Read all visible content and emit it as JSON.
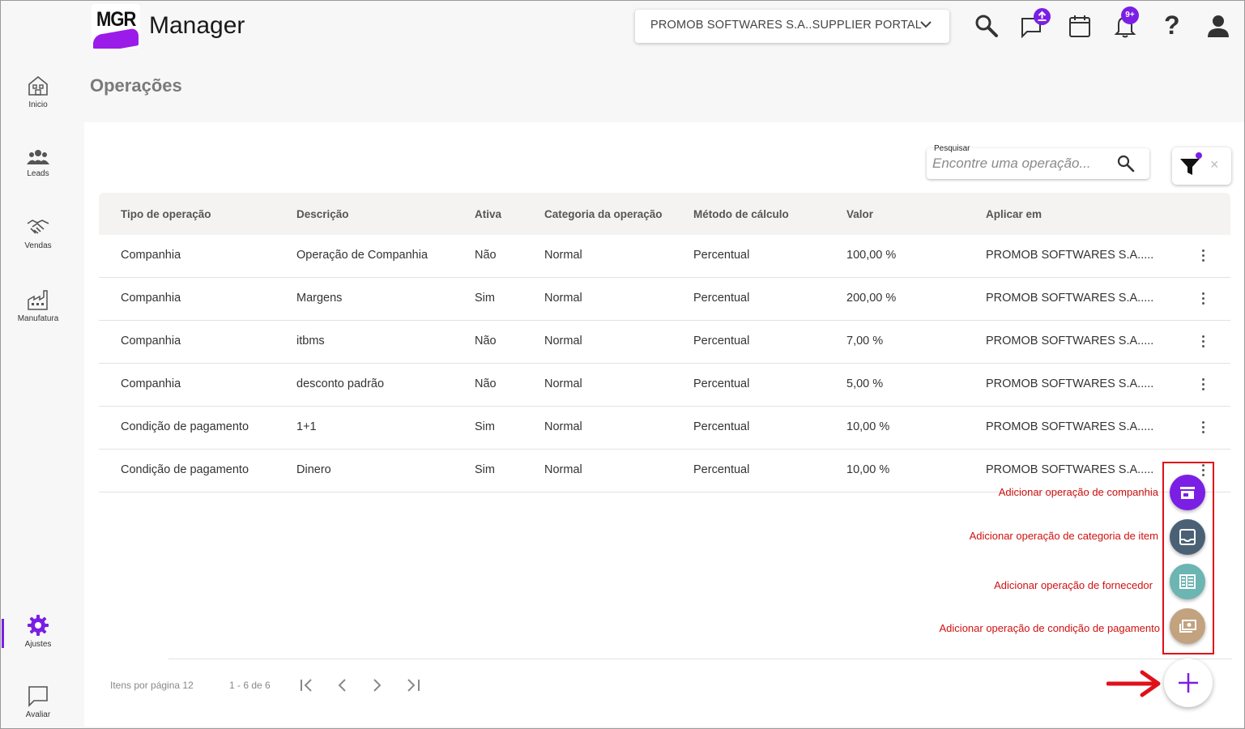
{
  "app": {
    "logo_text": "MGR",
    "name": "Manager"
  },
  "header": {
    "company": "PROMOB SOFTWARES S.A..SUPPLIER PORTAL",
    "chat_badge_icon": "upload-icon",
    "notifications_badge": "9+",
    "help_label": "?"
  },
  "sidebar": {
    "items": [
      {
        "label": "Inicio",
        "icon": "home-icon"
      },
      {
        "label": "Leads",
        "icon": "people-icon"
      },
      {
        "label": "Vendas",
        "icon": "handshake-icon"
      },
      {
        "label": "Manufatura",
        "icon": "factory-icon"
      },
      {
        "label": "Ajustes",
        "icon": "gear-icon"
      },
      {
        "label": "Avaliar",
        "icon": "chat-icon"
      }
    ],
    "active": "Ajustes"
  },
  "page": {
    "title": "Operações"
  },
  "search": {
    "label": "Pesquisar",
    "placeholder": "Encontre uma operação..."
  },
  "filter": {
    "clear": "×"
  },
  "table": {
    "columns": [
      "Tipo de operação",
      "Descrição",
      "Ativa",
      "Categoria da operação",
      "Método de cálculo",
      "Valor",
      "Aplicar em"
    ],
    "rows": [
      [
        "Companhia",
        "Operação de Companhia",
        "Não",
        "Normal",
        "Percentual",
        "100,00 %",
        "PROMOB SOFTWARES S.A....."
      ],
      [
        "Companhia",
        "Margens",
        "Sim",
        "Normal",
        "Percentual",
        "200,00 %",
        "PROMOB SOFTWARES S.A....."
      ],
      [
        "Companhia",
        "itbms",
        "Não",
        "Normal",
        "Percentual",
        "7,00 %",
        "PROMOB SOFTWARES S.A....."
      ],
      [
        "Companhia",
        "desconto padrão",
        "Não",
        "Normal",
        "Percentual",
        "5,00 %",
        "PROMOB SOFTWARES S.A....."
      ],
      [
        "Condição de pagamento",
        "1+1",
        "Sim",
        "Normal",
        "Percentual",
        "10,00 %",
        "PROMOB SOFTWARES S.A....."
      ],
      [
        "Condição de pagamento",
        "Dinero",
        "Sim",
        "Normal",
        "Percentual",
        "10,00 %",
        "PROMOB SOFTWARES S.A....."
      ]
    ]
  },
  "pagination": {
    "items_per_page": "Itens por página 12",
    "range": "1 - 6 de 6"
  },
  "speed_dial": {
    "actions": [
      {
        "label": "Adicionar operação de companhia",
        "color": "#7b1fe4",
        "icon": "store-icon"
      },
      {
        "label": "Adicionar operação de categoria de item",
        "color": "#4a6175",
        "icon": "inbox-icon"
      },
      {
        "label": "Adicionar operação de fornecedor",
        "color": "#6bb5b2",
        "icon": "business-icon"
      },
      {
        "label": "Adicionar operação de condição de pagamento",
        "color": "#c2a27f",
        "icon": "payments-icon"
      }
    ],
    "main_icon": "plus-icon"
  },
  "colors": {
    "accent": "#7b1fe4",
    "annotation": "#e0101a"
  }
}
